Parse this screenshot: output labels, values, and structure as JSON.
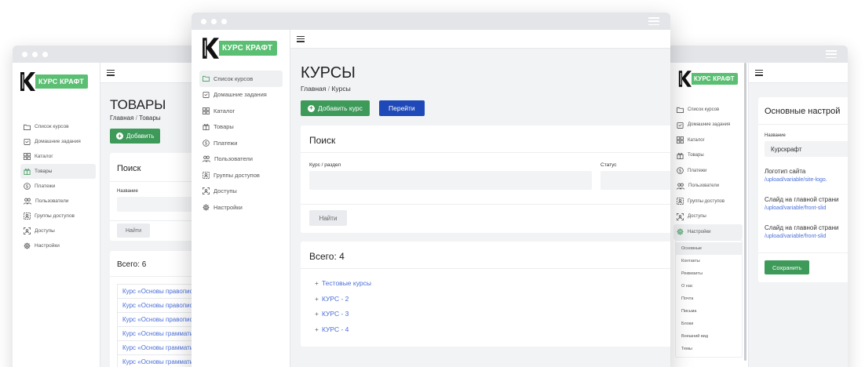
{
  "windows": {
    "left": {
      "logo_text": "КУРС КРАФТ",
      "nav": [
        {
          "label": "Список курсов",
          "icon": "folder-icon"
        },
        {
          "label": "Домашние задания",
          "icon": "clipboard-icon"
        },
        {
          "label": "Каталог",
          "icon": "grid-icon"
        },
        {
          "label": "Товары",
          "icon": "gift-icon"
        },
        {
          "label": "Платежи",
          "icon": "dollar-circle-icon"
        },
        {
          "label": "Пользователи",
          "icon": "users-icon"
        },
        {
          "label": "Группы доступов",
          "icon": "group-icon"
        },
        {
          "label": "Доступы",
          "icon": "access-icon"
        },
        {
          "label": "Настройки",
          "icon": "gear-icon"
        }
      ],
      "active_index": 3,
      "page_title": "ТОВАРЫ",
      "breadcrumb_home": "Главная",
      "breadcrumb_sep": "/",
      "breadcrumb_current": "Товары",
      "add_button": "Добавить",
      "search_title": "Поиск",
      "name_label": "Название",
      "find_button": "Найти",
      "total_label": "Всего: 6",
      "rows": [
        "Курс «Основы правопис",
        "Курс «Основы правопис",
        "Курс «Основы правопис",
        "Курс «Основы граммати",
        "Курс «Основы граммати",
        "Курс «Основы граммати"
      ]
    },
    "center": {
      "logo_text": "КУРС КРАФТ",
      "nav": [
        {
          "label": "Список курсов",
          "icon": "folder-icon"
        },
        {
          "label": "Домашние задания",
          "icon": "clipboard-icon"
        },
        {
          "label": "Каталог",
          "icon": "grid-icon"
        },
        {
          "label": "Товары",
          "icon": "gift-icon"
        },
        {
          "label": "Платежи",
          "icon": "dollar-circle-icon"
        },
        {
          "label": "Пользователи",
          "icon": "users-icon"
        },
        {
          "label": "Группы доступов",
          "icon": "group-icon"
        },
        {
          "label": "Доступы",
          "icon": "access-icon"
        },
        {
          "label": "Настройки",
          "icon": "gear-icon"
        }
      ],
      "active_index": 0,
      "page_title": "КУРСЫ",
      "breadcrumb_home": "Главная",
      "breadcrumb_sep": "/",
      "breadcrumb_current": "Курсы",
      "add_button": "Добавить курс",
      "go_button": "Перейти",
      "search_title": "Поиск",
      "course_label": "Курс / раздел",
      "status_label": "Статус",
      "find_button": "Найти",
      "total_label": "Всего: 4",
      "tree": [
        "Тестовые курсы",
        "КУРС - 2",
        "КУРС - 3",
        "КУРС - 4"
      ],
      "tree_prefix": "+"
    },
    "right": {
      "logo_text": "КУРС КРАФТ",
      "nav": [
        {
          "label": "Список курсов",
          "icon": "folder-icon"
        },
        {
          "label": "Домашние задания",
          "icon": "clipboard-icon"
        },
        {
          "label": "Каталог",
          "icon": "grid-icon"
        },
        {
          "label": "Товары",
          "icon": "gift-icon"
        },
        {
          "label": "Платежи",
          "icon": "dollar-circle-icon"
        },
        {
          "label": "Пользователи",
          "icon": "users-icon"
        },
        {
          "label": "Группы доступов",
          "icon": "group-icon"
        },
        {
          "label": "Доступы",
          "icon": "access-icon"
        },
        {
          "label": "Настройки",
          "icon": "gear-icon"
        }
      ],
      "active_index": 8,
      "submenu": [
        "Основные",
        "Контакты",
        "Реквизиты",
        "О нас",
        "Почта",
        "Письма",
        "Блоки",
        "Внешний вид",
        "Темы"
      ],
      "submenu_active": 0,
      "card_title": "Основные настрой",
      "name_label": "Название",
      "name_value": "Курскрафт",
      "logo_label": "Логотип сайта",
      "logo_path": "/upload/variable/site-logo.",
      "slide1_label": "Слайд на главной страни",
      "slide1_path": "/upload/variable/front-slid",
      "slide2_label": "Слайд на главной страни",
      "slide2_path": "/upload/variable/front-slid",
      "save_button": "Сохранить"
    }
  },
  "colors": {
    "accent_green": "#3d9a59",
    "logo_green": "#5bbf73",
    "primary_blue": "#1f49b9",
    "link_blue": "#4a6fd9"
  }
}
